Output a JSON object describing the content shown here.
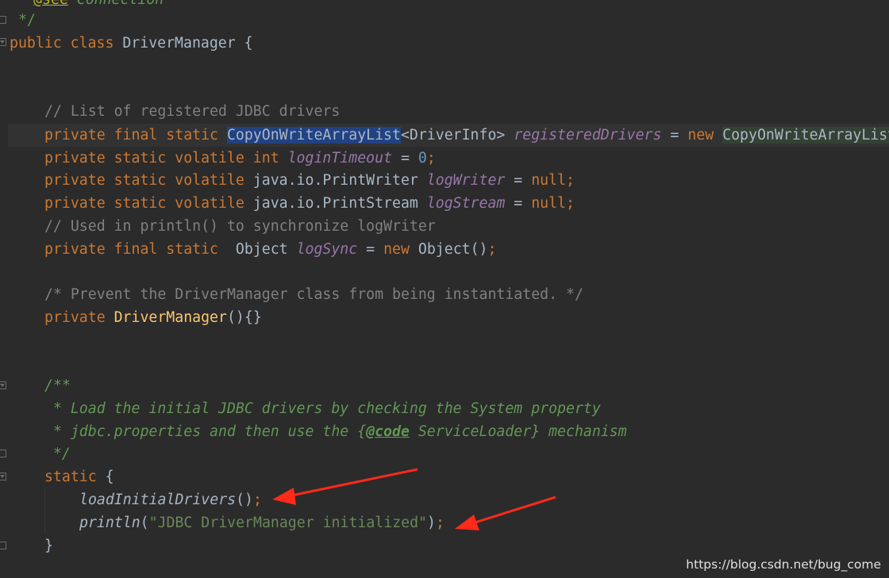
{
  "code": {
    "l0_tag": "@see",
    "l0_text": " Connection",
    "l1": " */",
    "l2_kw": "public class ",
    "l2_name": "DriverManager",
    "l2_rest": " {",
    "l3": "// List of registered JDBC drivers",
    "l4_kw": "private final static ",
    "l4_type": "CopyOnWriteArrayList",
    "l4_generic": "<DriverInfo> ",
    "l4_field": "registeredDrivers",
    "l4_eq": " = ",
    "l4_new": "new ",
    "l4_ctor": "CopyOnWriteArrayList",
    "l5_kw": "private static volatile int ",
    "l5_field": "loginTimeout",
    "l5_eq": " = ",
    "l5_val": "0",
    "l5_semi": ";",
    "l6_kw": "private static volatile ",
    "l6_type": "java.io.PrintWriter ",
    "l6_field": "logWriter",
    "l6_eq": " = ",
    "l6_val": "null;",
    "l7_kw": "private static volatile ",
    "l7_type": "java.io.PrintStream ",
    "l7_field": "logStream",
    "l7_eq": " = ",
    "l7_val": "null;",
    "l8": "// Used in println() to synchronize logWriter",
    "l9_kw": "private final static  ",
    "l9_type": "Object ",
    "l9_field": "logSync",
    "l9_eq": " = ",
    "l9_new": "new ",
    "l9_ctor": "Object()",
    "l9_semi": ";",
    "l10": "/* Prevent the DriverManager class from being instantiated. */",
    "l11_kw": "private ",
    "l11_name": "DriverManager",
    "l11_rest": "(){}",
    "l12": "/**",
    "l13": " * Load the initial JDBC drivers by checking the System property",
    "l14_a": " * jdbc.properties and then use the {",
    "l14_tag": "@code",
    "l14_b": " ServiceLoader} mechanism",
    "l15": " */",
    "l16_kw": "static ",
    "l16_rest": "{",
    "l17_call": "loadInitialDrivers",
    "l17_paren": "()",
    "l17_semi": ";",
    "l18_call": "println",
    "l18_open": "(",
    "l18_str": "\"JDBC DriverManager initialized\"",
    "l18_close": ")",
    "l18_semi": ";",
    "l19": "}"
  },
  "watermark": "https://blog.csdn.net/bug_come",
  "colors": {
    "background": "#2b2b2b",
    "keyword": "#cc7832",
    "comment": "#808080",
    "doc": "#629755",
    "field": "#9876aa",
    "number": "#6897bb",
    "string": "#6a8759",
    "method_decl": "#ffc66d",
    "selection": "#214283",
    "arrow": "#ff2a1a"
  }
}
